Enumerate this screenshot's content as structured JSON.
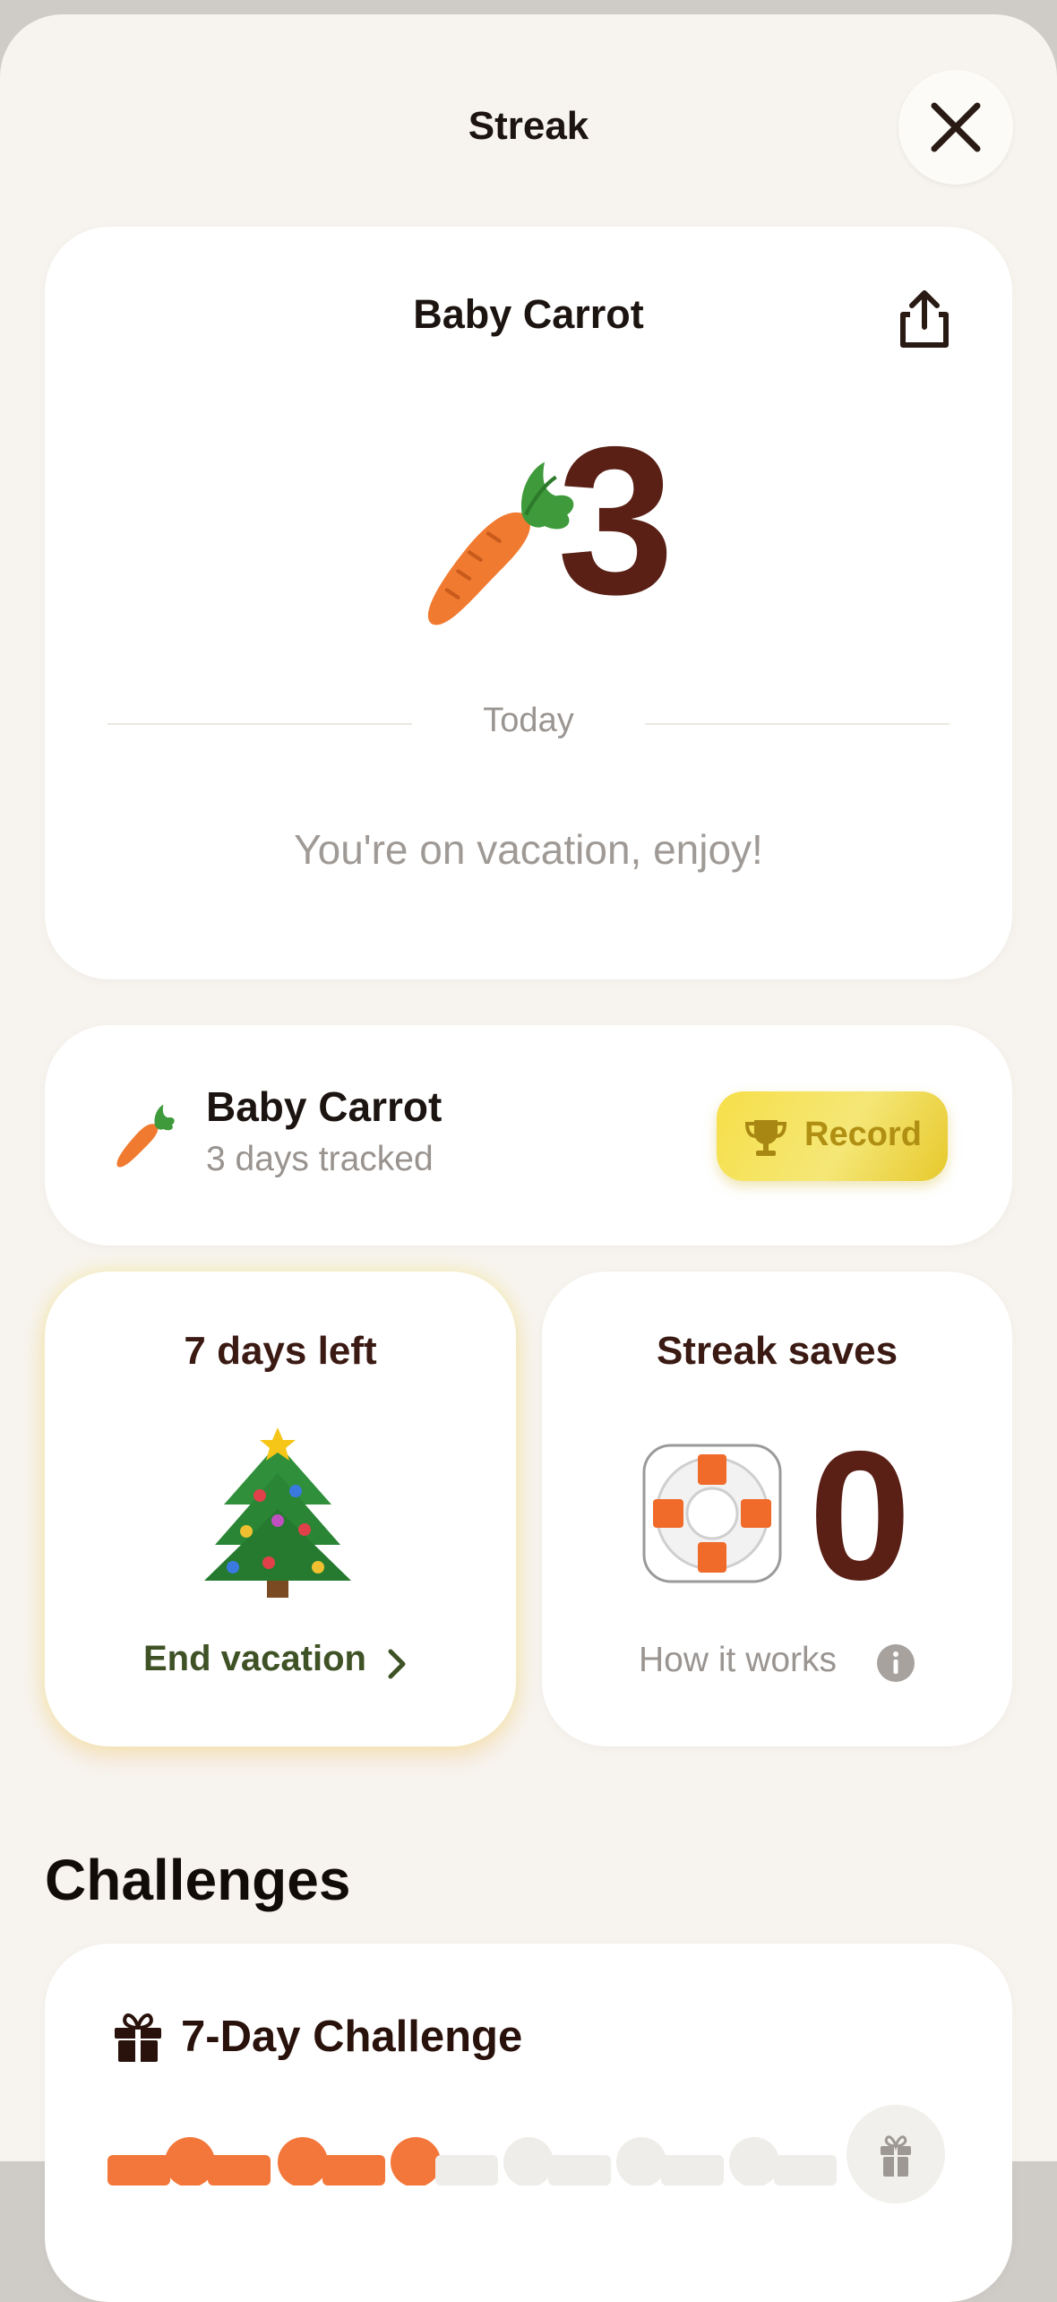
{
  "header": {
    "title": "Streak"
  },
  "main_card": {
    "title": "Baby Carrot",
    "streak_count": "3",
    "date_label": "Today",
    "status_message": "You're on vacation, enjoy!"
  },
  "level_card": {
    "name": "Baby Carrot",
    "subtitle": "3 days tracked",
    "record_label": "Record"
  },
  "vacation_card": {
    "title": "7 days left",
    "action_label": "End vacation"
  },
  "saves_card": {
    "title": "Streak saves",
    "count": "0",
    "help_label": "How it works"
  },
  "challenges": {
    "heading": "Challenges",
    "items": [
      {
        "title": "7-Day Challenge",
        "days_completed": 3,
        "days_total": 7
      }
    ]
  },
  "colors": {
    "background": "#f7f4ef",
    "accent_orange": "#f3763a",
    "streak_number": "#5a2016",
    "record_yellow": "#f5e060",
    "vacation_green": "#3f5226"
  },
  "icons": [
    "close-icon",
    "share-icon",
    "carrot-icon",
    "trophy-icon",
    "christmas-tree-icon",
    "chevron-right-icon",
    "life-ring-icon",
    "info-icon",
    "gift-icon"
  ]
}
